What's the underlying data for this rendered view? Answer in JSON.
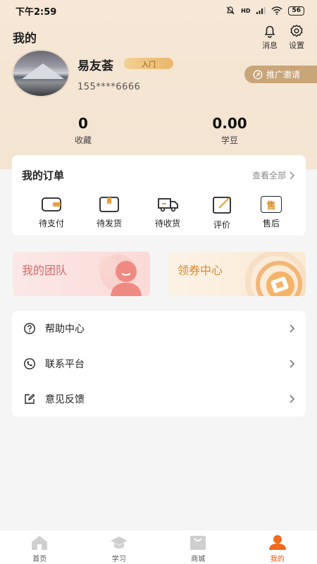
{
  "status_bar": {
    "time": "下午2:59",
    "network": "HD",
    "battery": "56"
  },
  "header": {
    "title": "我的",
    "messages_label": "消息",
    "settings_label": "设置"
  },
  "profile": {
    "name": "易友荟",
    "level": "入门",
    "phone": "155****6666",
    "invite_label": "推广邀请"
  },
  "stats": [
    {
      "value": "0",
      "label": "收藏"
    },
    {
      "value": "0.00",
      "label": "学豆"
    }
  ],
  "orders": {
    "title": "我的订单",
    "view_all": "查看全部",
    "items": [
      {
        "label": "待支付",
        "icon": "wallet-icon"
      },
      {
        "label": "待发货",
        "icon": "box-icon"
      },
      {
        "label": "待收货",
        "icon": "truck-icon"
      },
      {
        "label": "评价",
        "icon": "edit-icon"
      },
      {
        "label": "售后",
        "icon": "after-sales-icon",
        "glyph": "售"
      }
    ]
  },
  "promos": [
    {
      "label": "我的团队",
      "icon": "team-icon"
    },
    {
      "label": "领券中心",
      "icon": "coupon-icon"
    }
  ],
  "menu": [
    {
      "label": "帮助中心",
      "icon": "question-icon"
    },
    {
      "label": "联系平台",
      "icon": "phone-icon"
    },
    {
      "label": "意见反馈",
      "icon": "feedback-icon"
    }
  ],
  "tabbar": [
    {
      "label": "首页",
      "icon": "home-icon",
      "active": false
    },
    {
      "label": "学习",
      "icon": "graduation-cap-icon",
      "active": false
    },
    {
      "label": "商城",
      "icon": "shopping-bag-icon",
      "active": false
    },
    {
      "label": "我的",
      "icon": "user-icon",
      "active": true
    }
  ],
  "colors": {
    "accent": "#e65a10",
    "header_bg": "#f6e7d6",
    "invite_bg": "#c9a57a"
  }
}
